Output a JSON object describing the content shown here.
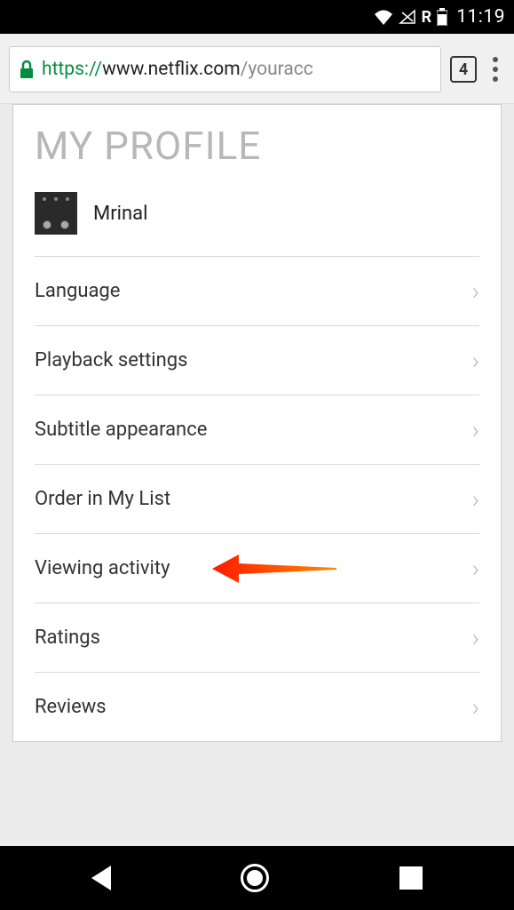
{
  "statusBar": {
    "roaming": "R",
    "time": "11:19"
  },
  "browser": {
    "url": {
      "protocol": "https://",
      "host": "www.netflix.com",
      "path": "/youracc"
    },
    "tabCount": "4"
  },
  "profile": {
    "title": "MY PROFILE",
    "name": "Mrinal"
  },
  "menu": [
    {
      "label": "Language",
      "annotated": false
    },
    {
      "label": "Playback settings",
      "annotated": false
    },
    {
      "label": "Subtitle appearance",
      "annotated": false
    },
    {
      "label": "Order in My List",
      "annotated": false
    },
    {
      "label": "Viewing activity",
      "annotated": true
    },
    {
      "label": "Ratings",
      "annotated": false
    },
    {
      "label": "Reviews",
      "annotated": false
    }
  ]
}
